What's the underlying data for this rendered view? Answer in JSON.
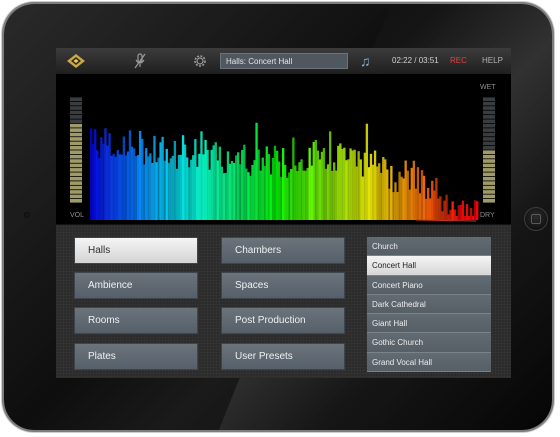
{
  "topbar": {
    "logo_icon": "diamond-logo-icon",
    "mic_icon": "muted-mic-icon",
    "settings_icon": "gear-icon",
    "preset_name": "Halls: Concert Hall",
    "music_icon": "music-note-icon",
    "music_glyph": "♫",
    "time": "02:22 / 03:51",
    "rec_label": "REC",
    "help_label": "HELP"
  },
  "meters": {
    "vol_label": "VOL",
    "wet_label": "WET",
    "dry_label": "DRY",
    "vol_level": 0.72,
    "wet_dry_level": 0.48
  },
  "categories": {
    "left": [
      "Halls",
      "Ambience",
      "Rooms",
      "Plates"
    ],
    "right": [
      "Chambers",
      "Spaces",
      "Post Production",
      "User Presets"
    ],
    "selected": "Halls"
  },
  "presets": {
    "items": [
      "Church",
      "Concert Hall",
      "Concert Piano",
      "Dark Cathedral",
      "Giant Hall",
      "Gothic Church",
      "Grand Vocal Hall"
    ],
    "selected": "Concert Hall"
  },
  "colors": {
    "rec": "#e04040",
    "accent_blue": "#8ab0d8",
    "selected_bg": "#e8e8e8"
  }
}
